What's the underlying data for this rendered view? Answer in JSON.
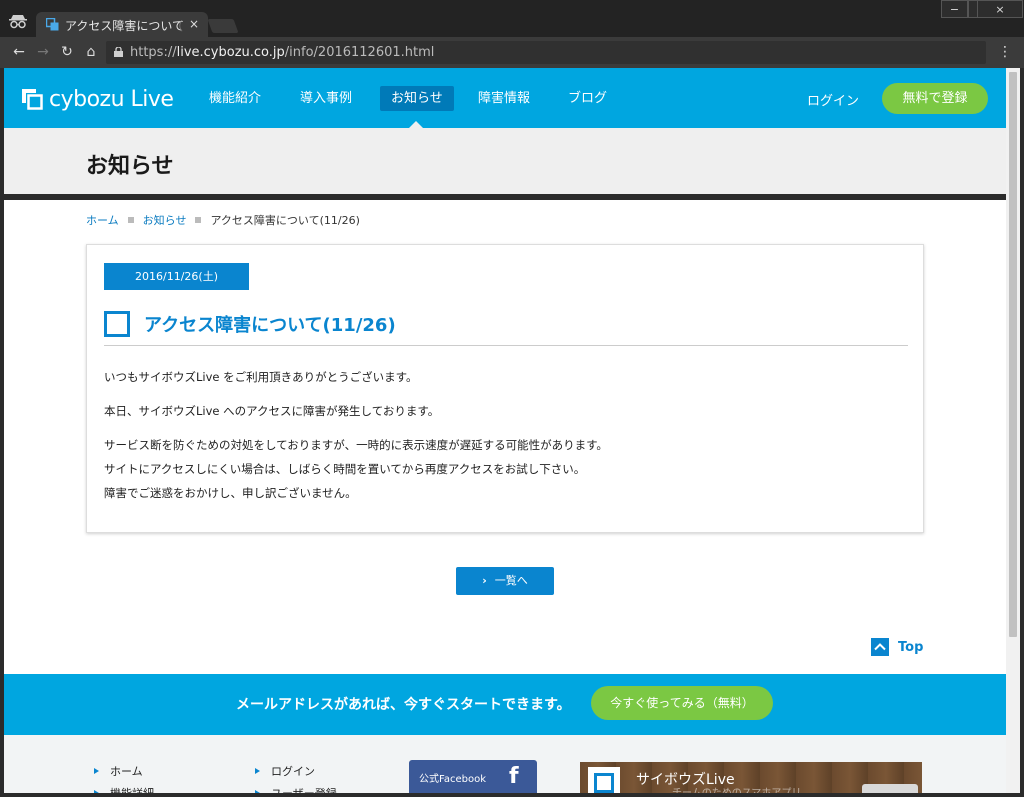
{
  "browser": {
    "tab_title": "アクセス障害について",
    "tab_fade": "（",
    "tab_close": "×",
    "url_scheme": "https://",
    "url_host": "live.cybozu.co.jp",
    "url_path": "/info/2016112601.html",
    "window_minimize": "−",
    "window_maximize": "□",
    "window_close": "×"
  },
  "header": {
    "logo": "cybozu Live",
    "nav": [
      "機能紹介",
      "導入事例",
      "お知らせ",
      "障害情報",
      "ブログ"
    ],
    "active_nav": "お知らせ",
    "login": "ログイン",
    "signup": "無料で登録"
  },
  "page": {
    "title": "お知らせ",
    "breadcrumb": [
      "ホーム",
      "お知らせ",
      "アクセス障害について(11/26)"
    ]
  },
  "article": {
    "date": "2016/11/26(土)",
    "title": "アクセス障害について(11/26)",
    "p1": "いつもサイボウズLive をご利用頂きありがとうございます。",
    "p2": "本日、サイボウズLive へのアクセスに障害が発生しております。",
    "p3_1": "サービス断を防ぐための対処をしておりますが、一時的に表示速度が遅延する可能性があります。",
    "p3_2": "サイトにアクセスしにくい場合は、しばらく時間を置いてから再度アクセスをお試し下さい。",
    "p3_3": "障害でご迷惑をおかけし、申し訳ございません。"
  },
  "list_button": "一覧へ",
  "top_link": "Top",
  "cta": {
    "text": "メールアドレスがあれば、今すぐスタートできます。",
    "button": "今すぐ使ってみる（無料）"
  },
  "footer": {
    "col1": [
      "ホーム",
      "機能詳細"
    ],
    "col2": [
      "ログイン",
      "ユーザー登録"
    ],
    "facebook_label": "公式Facebook",
    "promo_title": "サイボウズLive",
    "promo_sub": "チームのためのスマホアプリ"
  },
  "colors": {
    "brand_blue": "#00a6e0",
    "accent_blue": "#0a85cf",
    "green": "#7bc843"
  }
}
